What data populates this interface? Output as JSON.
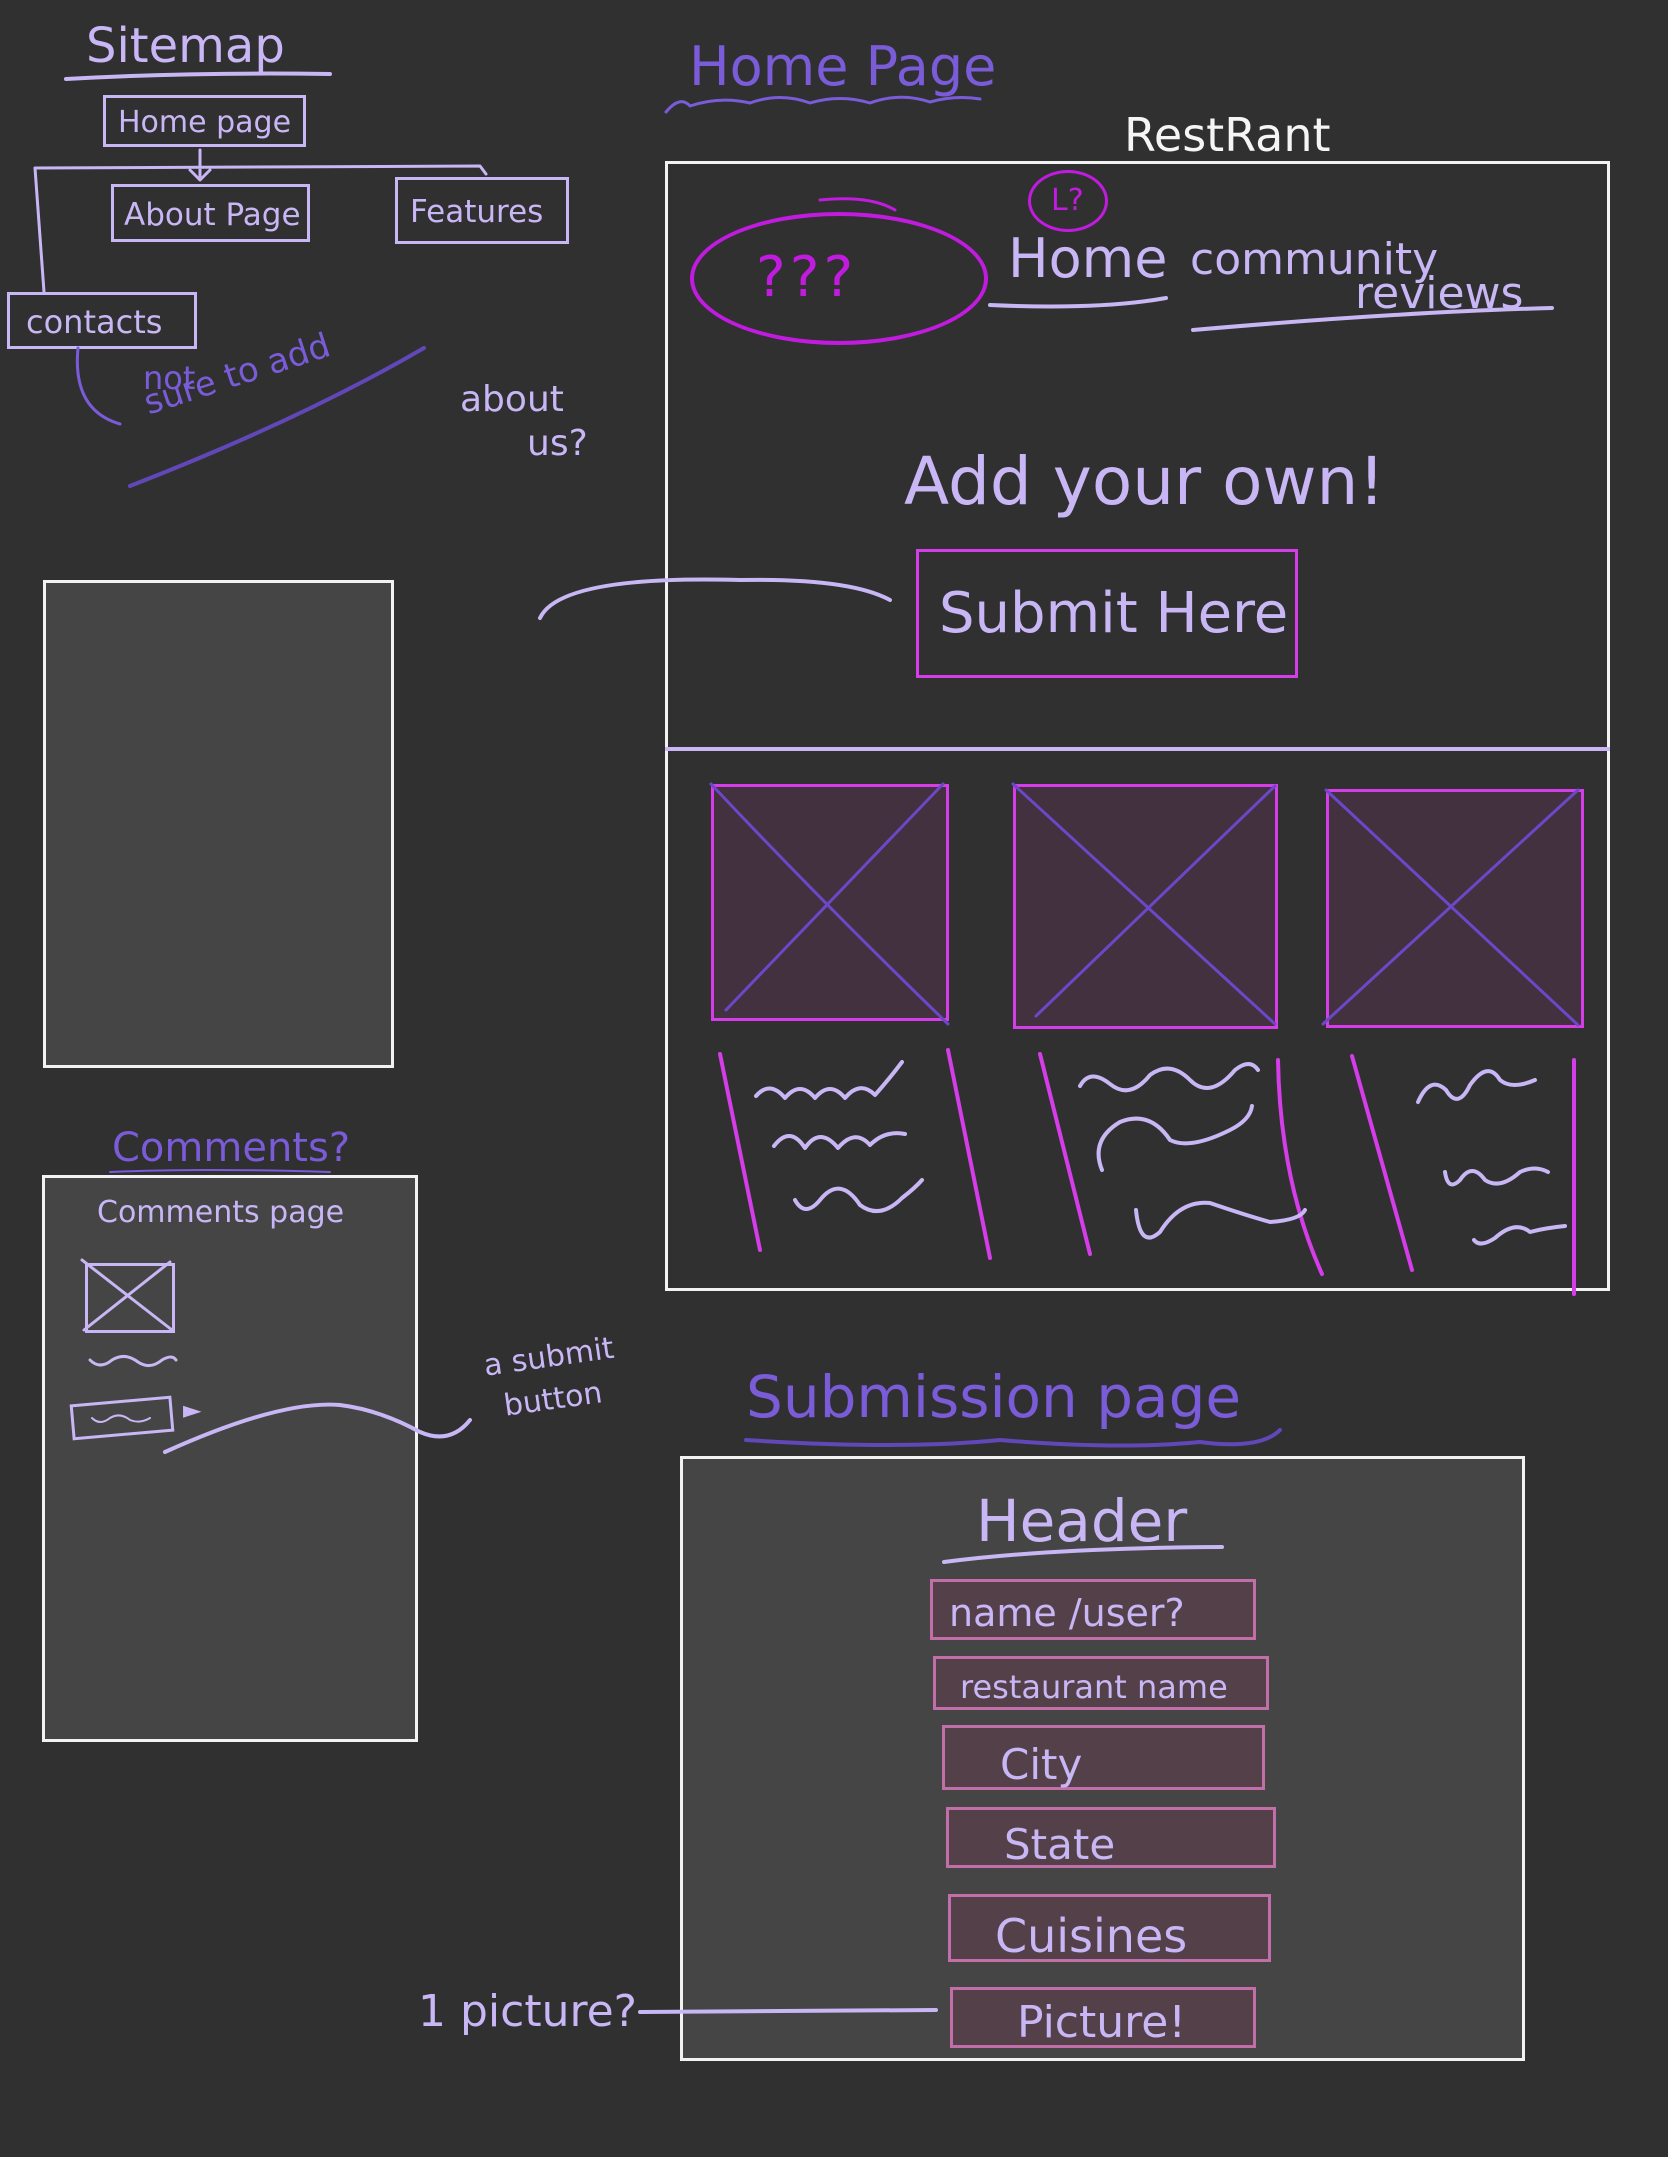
{
  "sitemap": {
    "title": "Sitemap",
    "home_page": "Home page",
    "about_page": "About Page",
    "features": "Features",
    "contacts": "contacts",
    "note_line1": "not",
    "note_line2": "sure to add"
  },
  "about_us_note": {
    "line1": "about",
    "line2": "us?"
  },
  "home": {
    "label": "Home Page",
    "brand": "RestRant",
    "logo_text": "???",
    "logo_marker": "L?",
    "nav_home": "Home",
    "nav_community_line1": "community",
    "nav_community_line2": "reviews",
    "hero_text": "Add your own!",
    "submit_button": "Submit Here"
  },
  "comments": {
    "label": "Comments?",
    "page_title": "Comments page",
    "note_line1": "a submit",
    "note_line2": "button"
  },
  "submission": {
    "label": "Submission page",
    "header": "Header",
    "fields": [
      "name /user?",
      "restaurant name",
      "City",
      "State",
      "Cuisines",
      "Picture!"
    ],
    "picture_note": "1 picture?"
  }
}
